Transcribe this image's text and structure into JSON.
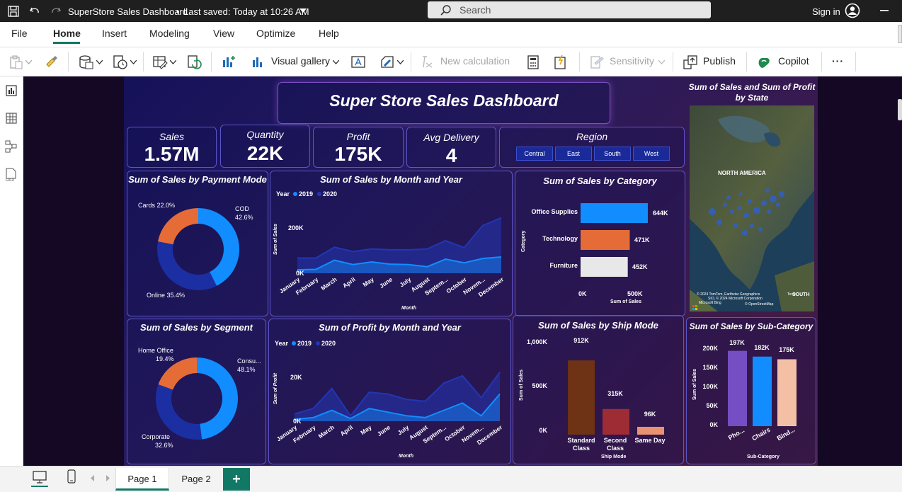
{
  "titlebar": {
    "title": "SuperStore Sales Dashboard",
    "saved": "Last saved: Today at 10:26 AM",
    "search_placeholder": "Search",
    "signin": "Sign in"
  },
  "menu": [
    "File",
    "Home",
    "Insert",
    "Modeling",
    "View",
    "Optimize",
    "Help"
  ],
  "toolbar": {
    "visual_gallery": "Visual gallery",
    "new_calculation": "New calculation",
    "sensitivity": "Sensitivity",
    "publish": "Publish",
    "copilot": "Copilot",
    "more": "···"
  },
  "dashboard": {
    "title": "Super Store Sales Dashboard",
    "kpis": [
      {
        "label": "Sales",
        "value": "1.57M"
      },
      {
        "label": "Quantity",
        "value": "22K"
      },
      {
        "label": "Profit",
        "value": "175K"
      },
      {
        "label": "Avg Delivery",
        "value": "4"
      }
    ],
    "region": {
      "title": "Region",
      "options": [
        "Central",
        "East",
        "South",
        "West"
      ]
    },
    "map": {
      "title": "Sum of Sales and Sum of Profit by State",
      "label": "NORTH AMERICA",
      "south": "SOUTH",
      "attribution1": "© 2024 TomTom, Earthstar Geographics",
      "attribution2": "SIO, © 2024 Microsoft Corporation",
      "attribution3": "© OpenStreetMap",
      "brand": "Microsoft Bing",
      "terms": "Terms"
    }
  },
  "chart_data": [
    {
      "type": "pie",
      "title": "Sum of Sales by Payment Mode",
      "labels": [
        "COD",
        "Online",
        "Cards"
      ],
      "values": [
        42.6,
        35.4,
        22.0
      ],
      "label_texts": [
        "COD",
        "42.6%",
        "Online 35.4%",
        "Cards 22.0%"
      ],
      "colors": [
        "#118dff",
        "#1b2fa3",
        "#e66c37"
      ]
    },
    {
      "type": "area",
      "title": "Sum of Sales by Month and Year",
      "legend_title": "Year",
      "x": [
        "January",
        "February",
        "March",
        "April",
        "May",
        "June",
        "July",
        "August",
        "Septem...",
        "October",
        "Novem...",
        "December"
      ],
      "series": [
        {
          "name": "2019",
          "color": "#118dff",
          "values": [
            16000,
            18000,
            60000,
            40000,
            52000,
            42000,
            40000,
            30000,
            65000,
            48000,
            68000,
            75000
          ]
        },
        {
          "name": "2020",
          "color": "#2236b5",
          "values": [
            70000,
            70000,
            120000,
            100000,
            112000,
            108000,
            108000,
            112000,
            150000,
            118000,
            220000,
            255000
          ]
        }
      ],
      "xlabel": "Month",
      "ylabel": "Sum of Sales",
      "yticks": [
        "0K",
        "200K"
      ],
      "ylim": [
        0,
        300000
      ]
    },
    {
      "type": "bar",
      "title": "Sum of Sales by Category",
      "categories": [
        "Office Supplies",
        "Technology",
        "Furniture"
      ],
      "values": [
        644000,
        471000,
        452000
      ],
      "value_labels": [
        "644K",
        "471K",
        "452K"
      ],
      "colors": [
        "#118dff",
        "#e66c37",
        "#e8e8e8"
      ],
      "xlabel": "Sum of Sales",
      "ylabel": "Category",
      "xticks": [
        "0K",
        "500K"
      ],
      "xlim": [
        0,
        700000
      ]
    },
    {
      "type": "pie",
      "title": "Sum of Sales by Segment",
      "labels": [
        "Consumer",
        "Corporate",
        "Home Office"
      ],
      "values": [
        48.1,
        32.6,
        19.4
      ],
      "label_texts": [
        "Consu...",
        "48.1%",
        "Corporate",
        "32.6%",
        "Home Office",
        "19.4%"
      ],
      "colors": [
        "#118dff",
        "#1b2fa3",
        "#e66c37"
      ]
    },
    {
      "type": "area",
      "title": "Sum of Profit by Month and Year",
      "legend_title": "Year",
      "x": [
        "January",
        "February",
        "March",
        "April",
        "May",
        "June",
        "July",
        "August",
        "Septem...",
        "October",
        "Novem...",
        "December"
      ],
      "series": [
        {
          "name": "2019",
          "color": "#118dff",
          "values": [
            1000,
            2000,
            6000,
            1500,
            7000,
            5000,
            3000,
            2000,
            6000,
            10000,
            3000,
            15000
          ]
        },
        {
          "name": "2020",
          "color": "#2236b5",
          "values": [
            4000,
            7000,
            18000,
            3000,
            16000,
            15000,
            12000,
            11000,
            21000,
            25000,
            13000,
            27000
          ]
        }
      ],
      "xlabel": "Month",
      "ylabel": "Sum of Profit",
      "yticks": [
        "0K",
        "20K"
      ],
      "ylim": [
        0,
        32000
      ]
    },
    {
      "type": "bar",
      "title": "Sum of Sales by Ship Mode",
      "categories": [
        "Standard Class",
        "Second Class",
        "Same Day"
      ],
      "values": [
        912000,
        315000,
        96000
      ],
      "value_labels": [
        "912K",
        "315K",
        "96K"
      ],
      "colors": [
        "#6e3214",
        "#9e2c34",
        "#e89272"
      ],
      "xlabel": "Ship Mode",
      "ylabel": "Sum of Sales",
      "yticks": [
        "0K",
        "500K",
        "1,000K"
      ],
      "ylim": [
        0,
        1000000
      ]
    },
    {
      "type": "bar",
      "title": "Sum of Sales by Sub-Category",
      "categories": [
        "Pho...",
        "Chairs",
        "Bind..."
      ],
      "values": [
        197000,
        182000,
        175000
      ],
      "value_labels": [
        "197K",
        "182K",
        "175K"
      ],
      "colors": [
        "#744ec2",
        "#118dff",
        "#f3c0a6"
      ],
      "xlabel": "Sub-Category",
      "ylabel": "Sum of Sales",
      "yticks": [
        "0K",
        "50K",
        "100K",
        "150K",
        "200K"
      ],
      "ylim": [
        0,
        200000
      ]
    }
  ],
  "pages": [
    "Page 1",
    "Page 2"
  ],
  "add_page": "+"
}
